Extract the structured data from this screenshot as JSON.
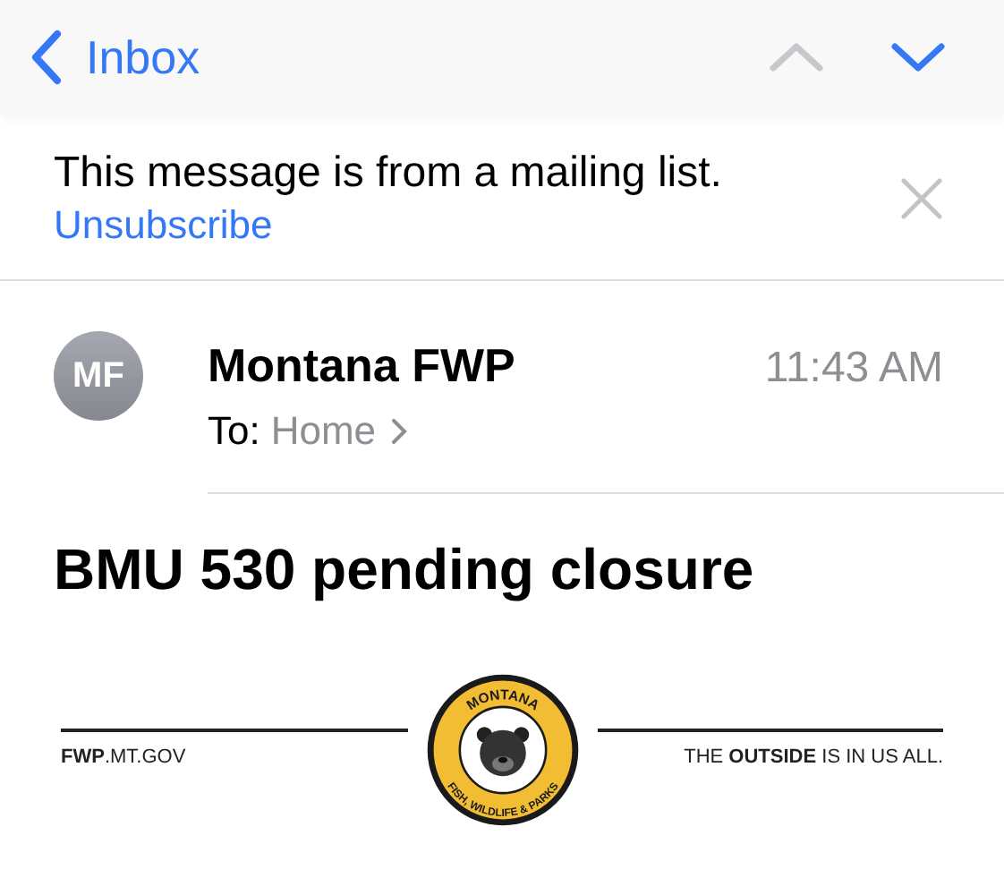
{
  "nav": {
    "back_label": "Inbox",
    "previous": {
      "disabled": true
    },
    "next": {
      "disabled": false
    }
  },
  "banner": {
    "message": "This message is from a mailing list.",
    "link": "Unsubscribe"
  },
  "message": {
    "avatar_initials": "MF",
    "sender": "Montana FWP",
    "time": "11:43 AM",
    "to_label": "To:",
    "to_value": "Home",
    "subject": "BMU 530 pending closure"
  },
  "footer": {
    "left": "**FWP**.MT.GOV",
    "seal_top": "MONTANA",
    "seal_bottom": "FISH, WILDLIFE & PARKS",
    "right": "THE **OUTSIDE** IS IN US ALL."
  }
}
